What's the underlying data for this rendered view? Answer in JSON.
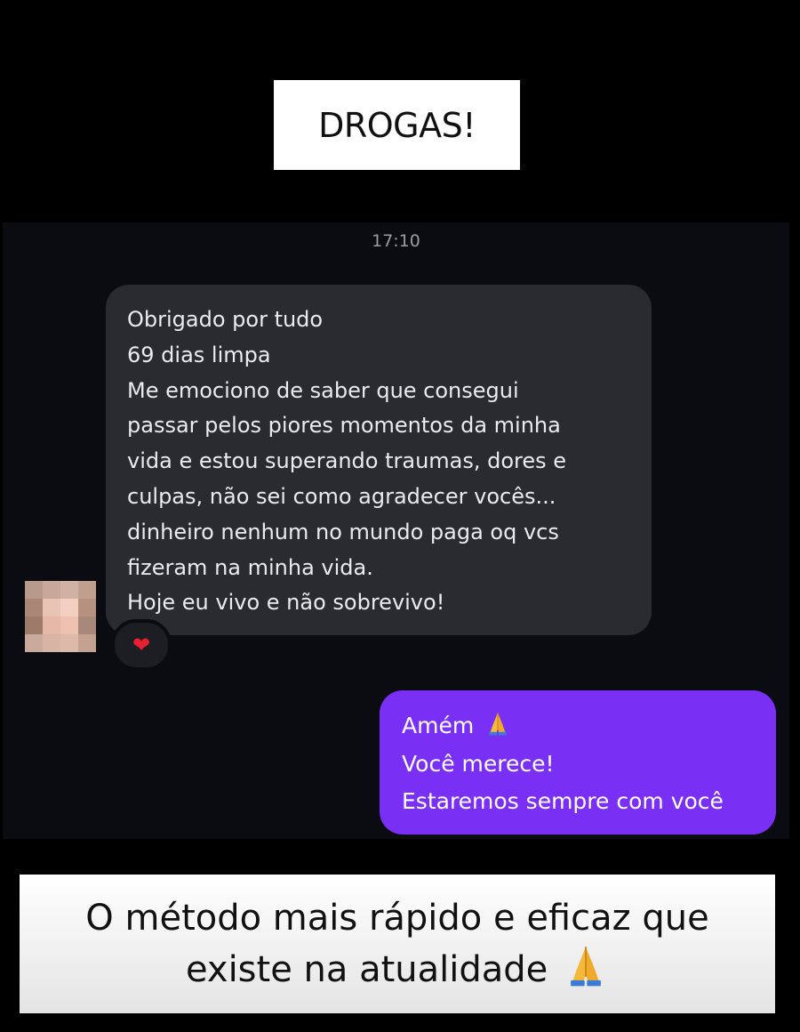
{
  "header": {
    "title": "DROGAS!"
  },
  "chat": {
    "timestamp": "17:10",
    "incoming": {
      "lines": [
        "Obrigado por tudo",
        "69 dias limpa",
        "Me emociono de saber que consegui",
        "passar pelos piores momentos da minha",
        "vida e estou superando traumas, dores e",
        "culpas, não sei como agradecer vocês...",
        "dinheiro nenhum no mundo paga oq vcs",
        "fizeram na minha vida.",
        "Hoje eu vivo e não sobrevivo!"
      ],
      "reaction": "❤"
    },
    "outgoing": {
      "lines": [
        "Amém",
        "Você merece!",
        "Estaremos sempre com você"
      ],
      "bubble_color": "#7a2ff5"
    },
    "avatar_icon": "pixelated-avatar-icon"
  },
  "footer": {
    "line1": "O método mais rápido e eficaz que",
    "line2": "existe na atualidade"
  },
  "colors": {
    "background": "#000000",
    "chat_bg": "#0b0b12",
    "incoming_bubble": "#2a2a31",
    "outgoing_bubble": "#7a2ff5"
  },
  "icons": {
    "pray": "pray-hands-icon",
    "heart": "heart-icon"
  }
}
